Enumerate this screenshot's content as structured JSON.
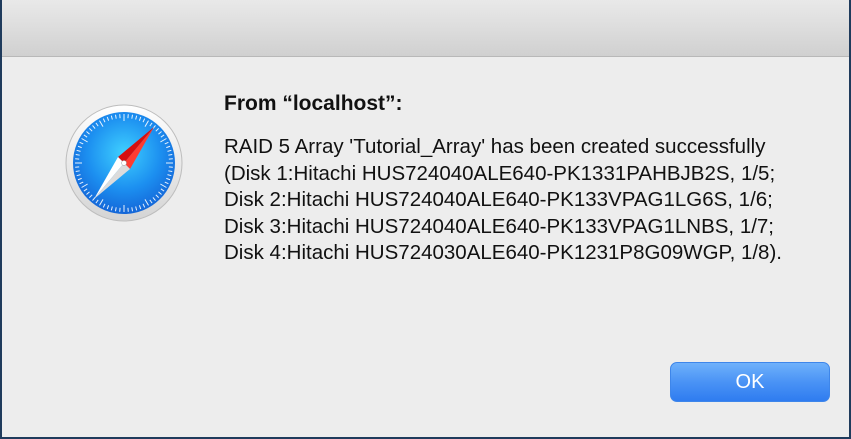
{
  "dialog": {
    "title": "From “localhost”:",
    "message": "RAID 5 Array 'Tutorial_Array' has been created successfully (Disk 1:Hitachi HUS724040ALE640-PK1331PAHBJB2S, 1/5; Disk 2:Hitachi HUS724040ALE640-PK133VPAG1LG6S, 1/6; Disk 3:Hitachi HUS724040ALE640-PK133VPAG1LNBS, 1/7; Disk 4:Hitachi HUS724030ALE640-PK1231P8G09WGP, 1/8).",
    "ok_label": "OK",
    "icon": "safari-compass-icon"
  },
  "colors": {
    "accent": "#3b8af3",
    "window_border": "#1f3b5c",
    "dialog_bg": "#ededed"
  }
}
